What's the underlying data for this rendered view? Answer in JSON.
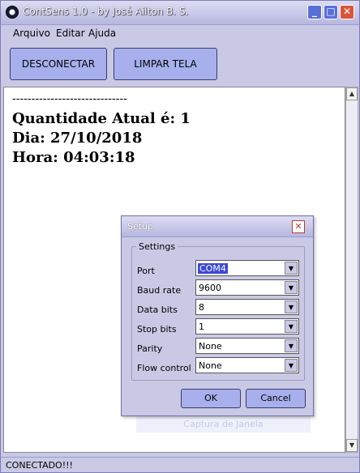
{
  "window": {
    "title": "ContSens 1.0 - by José Ailton B. S."
  },
  "menubar": {
    "items": [
      "Arquivo",
      "Editar",
      "Ajuda"
    ]
  },
  "toolbar": {
    "disconnect_label": "DESCONECTAR",
    "clear_label": "LIMPAR TELA"
  },
  "log": {
    "separator": "------------------------------",
    "line1": "Quantidade Atual é: 1",
    "line2": "Dia: 27/10/2018",
    "line3": "Hora: 04:03:18"
  },
  "dialog": {
    "title": "Setup",
    "group_label": "Settings",
    "fields": [
      {
        "label": "Port",
        "value": "COM4"
      },
      {
        "label": "Baud rate",
        "value": "9600"
      },
      {
        "label": "Data bits",
        "value": "8"
      },
      {
        "label": "Stop bits",
        "value": "1"
      },
      {
        "label": "Parity",
        "value": "None"
      },
      {
        "label": "Flow control",
        "value": "None"
      }
    ],
    "ok_label": "OK",
    "cancel_label": "Cancel"
  },
  "ghost_tooltip": "Captura de Janela",
  "status": {
    "text": "CONECTADO!!!"
  },
  "icons": {
    "minimize": "minimize-icon",
    "maximize": "maximize-icon",
    "close": "close-icon",
    "dropdown": "chevron-down-icon"
  },
  "colors": {
    "button_fill": "#a7b0ec",
    "close_red": "#d9553a",
    "selection": "#3c48d6"
  }
}
